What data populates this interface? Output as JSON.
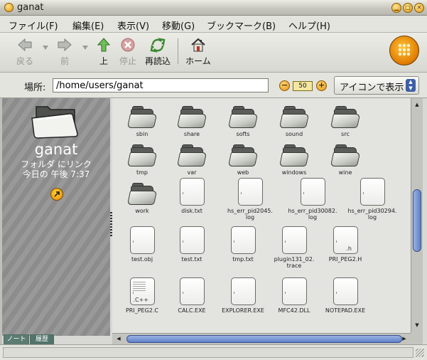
{
  "window": {
    "title": "ganat"
  },
  "menu": [
    {
      "label": "ファイル(F)"
    },
    {
      "label": "編集(E)"
    },
    {
      "label": "表示(V)"
    },
    {
      "label": "移動(G)"
    },
    {
      "label": "ブックマーク(B)"
    },
    {
      "label": "ヘルプ(H)"
    }
  ],
  "toolbar": {
    "back": "戻る",
    "forward": "前",
    "up": "上",
    "stop": "停止",
    "reload": "再読込",
    "home": "ホーム"
  },
  "location": {
    "label": "場所:",
    "value": "/home/users/ganat"
  },
  "zoom": {
    "value": "50"
  },
  "view_mode": {
    "selected": "アイコンで表示"
  },
  "side_pane": {
    "name": "ganat",
    "type": "フォルダ にリンク",
    "date": "今日の 午後 7:37",
    "tabs": [
      "ノート",
      "履歴"
    ]
  },
  "files": [
    {
      "name": "sbin",
      "kind": "folder"
    },
    {
      "name": "share",
      "kind": "folder"
    },
    {
      "name": "softs",
      "kind": "folder"
    },
    {
      "name": "sound",
      "kind": "folder"
    },
    {
      "name": "src",
      "kind": "folder"
    },
    {
      "name": "tmp",
      "kind": "folder"
    },
    {
      "name": "var",
      "kind": "folder"
    },
    {
      "name": "web",
      "kind": "folder"
    },
    {
      "name": "windows",
      "kind": "folder"
    },
    {
      "name": "wine",
      "kind": "folder"
    },
    {
      "name": "work",
      "kind": "folder"
    },
    {
      "name": "disk.txt",
      "kind": "doc"
    },
    {
      "name": "hs_err_pid2045.\nlog",
      "kind": "doc"
    },
    {
      "name": "hs_err_pid30082.\nlog",
      "kind": "doc"
    },
    {
      "name": "hs_err_pid30294.\nlog",
      "kind": "doc"
    },
    {
      "name": "test.obj",
      "kind": "doc"
    },
    {
      "name": "test.txt",
      "kind": "doc"
    },
    {
      "name": "tmp.txt",
      "kind": "doc"
    },
    {
      "name": "plugin131_02.\ntrace",
      "kind": "doc"
    },
    {
      "name": "PRI_PEG2.H",
      "kind": "doc",
      "ext": ".h"
    },
    {
      "name": "PRI_PEG2.C",
      "kind": "doc-c",
      "ext": ".C++"
    },
    {
      "name": "CALC.EXE",
      "kind": "doc"
    },
    {
      "name": "EXPLORER.EXE",
      "kind": "doc"
    },
    {
      "name": "MFC42.DLL",
      "kind": "doc"
    },
    {
      "name": "NOTEPAD.EXE",
      "kind": "doc"
    }
  ],
  "colors": {
    "accent": "#e38800",
    "scroll_thumb": "#5f80c7"
  }
}
